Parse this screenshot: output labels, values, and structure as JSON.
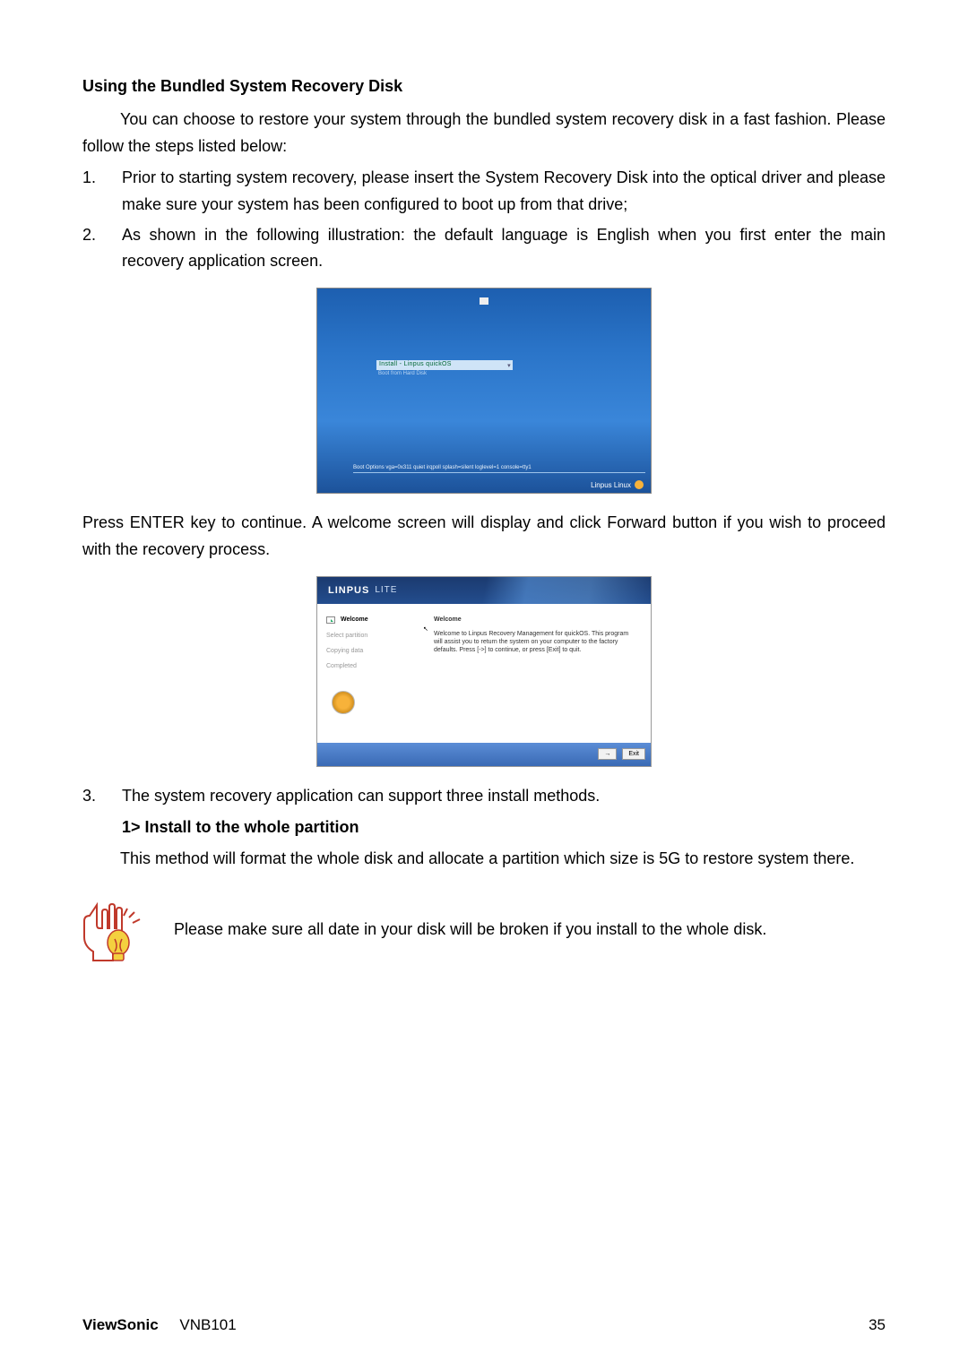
{
  "heading": "Using the Bundled System Recovery Disk",
  "intro": "You can choose to restore your system through the bundled system recovery disk in a fast fashion. Please follow the steps listed below:",
  "steps": [
    {
      "n": "1.",
      "t": "Prior to starting system recovery, please insert the System Recovery Disk into the optical driver and please make sure your system has been configured to boot up from that drive;"
    },
    {
      "n": "2.",
      "t": "As shown in the following illustration: the default language is English when you first enter the main recovery application screen."
    }
  ],
  "fig1": {
    "menu_selected": "Install - Linpus quickOS",
    "menu_sub": "Boot from Hard Disk",
    "boot_options": "Boot Options  vga=0x311 quiet irqpoll splash=silent loglevel=1 console=tty1",
    "brand": "Linpus Linux"
  },
  "after_fig1": "Press ENTER key to continue. A welcome screen will display and click Forward button if you wish to proceed with the recovery process.",
  "fig2": {
    "logo": "LINPUS",
    "lite": "LITE",
    "side_items": [
      "Welcome",
      "Select partition",
      "Copying data",
      "Completed"
    ],
    "right_title": "Welcome",
    "right_msg": "Welcome to Linpus Recovery Management for quickOS. This program will assist you to return the system on your computer to the factory defaults. Press [->] to continue, or press [Exit] to quit.",
    "btn_forward": "→",
    "btn_exit": "Exit"
  },
  "step3": {
    "n": "3.",
    "t": "The system recovery application can support three install methods."
  },
  "method1_h": "1> Install to the whole partition",
  "method1_p": "This method will format the whole disk and allocate a partition which size is 5G to restore system there.",
  "tip": "Please make sure all date in your disk will be broken if you install to the whole disk.",
  "footer": {
    "brand": "ViewSonic",
    "model": "VNB101",
    "page": "35"
  }
}
